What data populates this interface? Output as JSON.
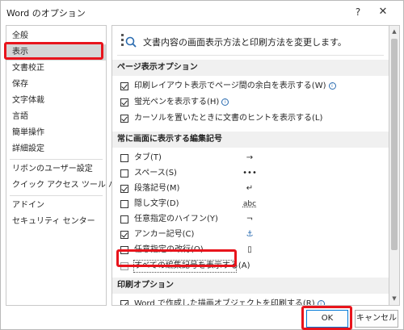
{
  "window": {
    "title": "Word のオプション",
    "help_glyph": "?",
    "close_glyph": "✕"
  },
  "nav": {
    "items": [
      "全般",
      "表示",
      "文書校正",
      "保存",
      "文字体裁",
      "言語",
      "簡単操作",
      "詳細設定",
      "リボンのユーザー設定",
      "クイック アクセス ツール バー",
      "アドイン",
      "セキュリティ センター"
    ],
    "selected_index": 1
  },
  "header": {
    "text": "文書内容の画面表示方法と印刷方法を変更します。"
  },
  "sections": {
    "page_display": {
      "title": "ページ表示オプション",
      "options": [
        {
          "label": "印刷レイアウト表示でページ間の余白を表示する(W)",
          "checked": true,
          "info": true
        },
        {
          "label": "蛍光ペンを表示する(H)",
          "checked": true,
          "info": true
        },
        {
          "label": "カーソルを置いたときに文書のヒントを表示する(L)",
          "checked": true,
          "info": false
        }
      ]
    },
    "formatting_marks": {
      "title": "常に画面に表示する編集記号",
      "options": [
        {
          "label": "タブ(T)",
          "checked": false,
          "symbol": "→"
        },
        {
          "label": "スペース(S)",
          "checked": false,
          "symbol": "•••"
        },
        {
          "label": "段落記号(M)",
          "checked": true,
          "symbol": "↵"
        },
        {
          "label": "隠し文字(D)",
          "checked": false,
          "symbol": "abc"
        },
        {
          "label": "任意指定のハイフン(Y)",
          "checked": false,
          "symbol": "¬"
        },
        {
          "label": "アンカー記号(C)",
          "checked": true,
          "symbol": "⚓"
        },
        {
          "label": "任意指定の改行(O)",
          "checked": false,
          "symbol": "▯"
        },
        {
          "label": "すべての編集記号を表示する(A)",
          "checked": false,
          "symbol": ""
        }
      ]
    },
    "print": {
      "title": "印刷オプション",
      "options": [
        {
          "label": "Word で作成した描画オブジェクトを印刷する(R)",
          "checked": true,
          "info": true
        }
      ]
    }
  },
  "buttons": {
    "ok": "OK",
    "cancel": "キャンセル"
  },
  "icons": {
    "info": "i",
    "scroll_up": "▲",
    "scroll_down": "▼"
  },
  "colors": {
    "highlight_red": "#e8141c",
    "selected_nav": "#d6d6d6",
    "section_bg": "#f0f0f0",
    "ok_border": "#0078d7"
  }
}
